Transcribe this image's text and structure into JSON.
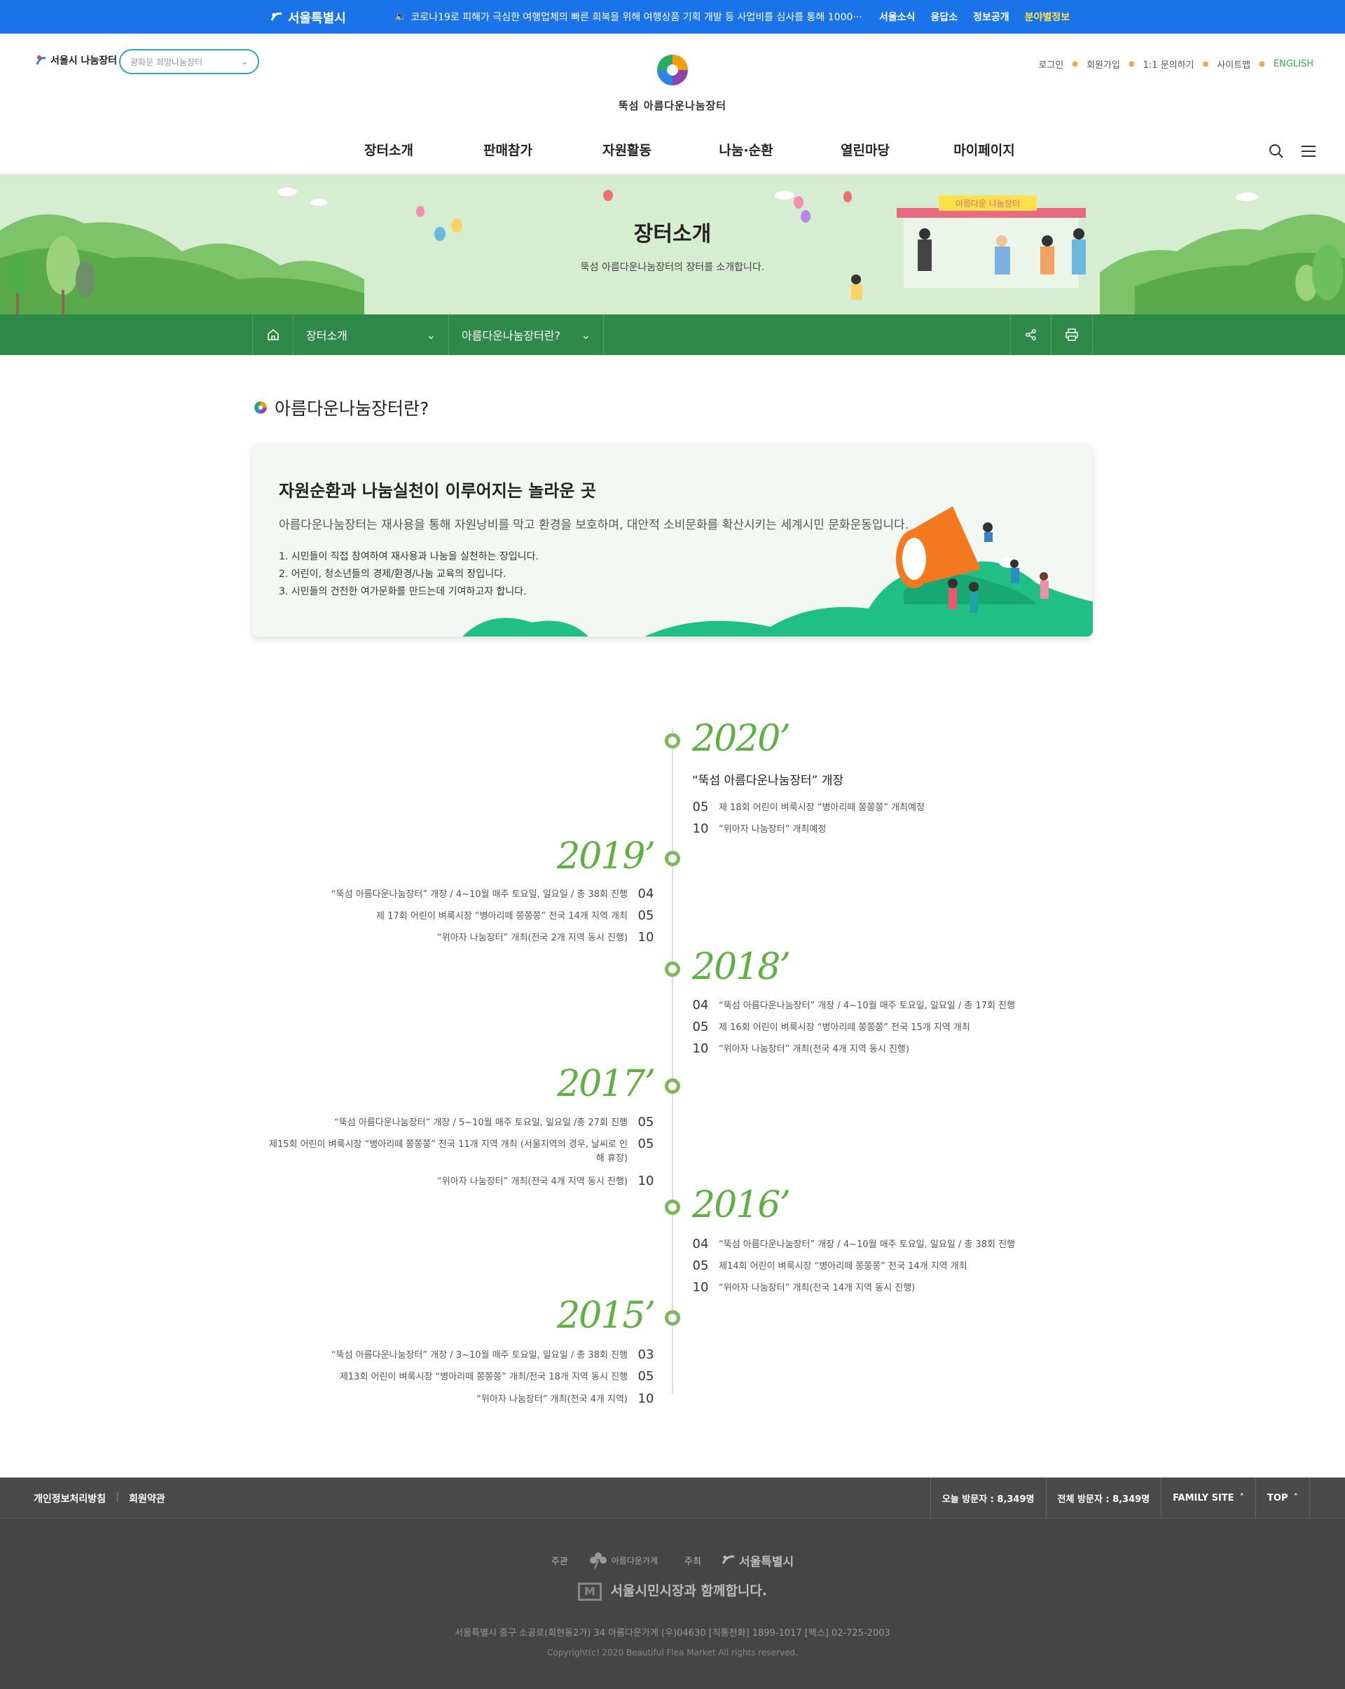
{
  "topbar": {
    "logo": "서울특별시",
    "notice": "코로나19로 피해가 극심한 여행업체의 빠른 회복을 위해 여행상품 기획 개발 등 사업비를 심사를 통해 1000···",
    "links": [
      "서울소식",
      "응답소",
      "정보공개",
      "분야별정보"
    ]
  },
  "header": {
    "site_logo": "서울시 나눔장터",
    "site_select": "광화문 희망나눔장터",
    "center_logo": "뚝섬 아름다운나눔장터",
    "util": [
      "로그인",
      "회원가입",
      "1:1 문의하기",
      "사이트맵",
      "ENGLISH"
    ],
    "gnb": [
      "장터소개",
      "판매참가",
      "자원활동",
      "나눔·순환",
      "열린마당",
      "마이페이지"
    ]
  },
  "banner": {
    "title": "장터소개",
    "subtitle": "뚝섬 아름다운나눔장터의 장터를 소개합니다.",
    "sign": "아름다운 나눔장터"
  },
  "locbar": {
    "depth1": "장터소개",
    "depth2": "아름다운나눔장터란?"
  },
  "section_title": "아름다운나눔장터란?",
  "intro": {
    "heading": "자원순환과 나눔실천이 이루어지는 놀라운 곳",
    "desc": "아름다운나눔장터는 재사용을 통해 자원낭비를 막고 환경을 보호하며, 대안적 소비문화를 확산시키는 세계시민 문화운동입니다.",
    "items": [
      "1. 시민들이 직접 참여하여 재사용과 나눔을 실천하는 장입니다.",
      "2. 어린이, 청소년들의 경제/환경/나눔 교육의 장입니다.",
      "3. 시민들의 건전한 여가문화를 만드는데 기여하고자 합니다."
    ]
  },
  "timeline": [
    {
      "year": "2020’",
      "title": "“뚝섬 아름다운나눔장터” 개장",
      "events": [
        {
          "m": "05",
          "t": "제 18회 어린이 벼룩시장 “병아리떼 쫑쫑쫑” 개최예정"
        },
        {
          "m": "10",
          "t": "“위아자 나눔장터” 개최예정"
        }
      ]
    },
    {
      "year": "2019’",
      "events": [
        {
          "m": "04",
          "t": "“뚝섬 아름다운나눔장터” 개장 / 4~10월 매주 토요일, 일요일 / 총 38회 진행"
        },
        {
          "m": "05",
          "t": "제 17회 어린이 벼룩시장 “병아리떼 쫑쫑쫑” 전국 14개 지역 개최"
        },
        {
          "m": "10",
          "t": "“위아자 나눔장터” 개최(전국 2개 지역 동시 진행)"
        }
      ]
    },
    {
      "year": "2018’",
      "events": [
        {
          "m": "04",
          "t": "“뚝섬 아름다운나눔장터” 개장 / 4~10월 매주 토요일, 일요일 / 총 17회 진행"
        },
        {
          "m": "05",
          "t": "제 16회 어린이 벼룩시장 “병아리떼 쫑쫑쫑” 전국 15개 지역 개최"
        },
        {
          "m": "10",
          "t": "“위아자 나눔장터” 개최(전국 4개 지역 동시 진행)"
        }
      ]
    },
    {
      "year": "2017’",
      "events": [
        {
          "m": "05",
          "t": "“뚝섬 아름다운나눔장터” 개장 / 5~10월 매주 토요일, 일요일 /총 27회 진행"
        },
        {
          "m": "05",
          "t": "제15회 어린이 벼룩시장 “병아리떼 쫑쫑쫑” 전국 11개 지역 개최 (서울지역의 경우, 날씨로 인해 휴장)"
        },
        {
          "m": "10",
          "t": "“위아자 나눔장터” 개최(전국 4개 지역 동시 진행)"
        }
      ]
    },
    {
      "year": "2016’",
      "events": [
        {
          "m": "04",
          "t": "“뚝섬 아름다운나눔장터” 개장 / 4~10월 매주 토요일, 일요일 / 총 38회 진행"
        },
        {
          "m": "05",
          "t": "제14회 어린이 벼룩시장 “병아리떼 쫑쫑쫑” 전국 14개 지역 개최"
        },
        {
          "m": "10",
          "t": "“위아자 나눔장터” 개최(전국 14개 지역 동시 진행)"
        }
      ]
    },
    {
      "year": "2015’",
      "events": [
        {
          "m": "03",
          "t": "“뚝섬 아름다운나눔장터” 개장 / 3~10월 매주 토요일, 일요일 / 총 38회 진행"
        },
        {
          "m": "05",
          "t": "제13회 어린이 벼룩시장 “병아리떼 쫑쫑쫑” 개최/전국 18개 지역 동시 진행"
        },
        {
          "m": "10",
          "t": "“위아자 나눔장터” 개최(전국 4개 지역)"
        }
      ]
    }
  ],
  "footer": {
    "links": [
      "개인정보처리방침",
      "회원약관"
    ],
    "today": "오늘 방문자 : 8,349명",
    "total": "전체 방문자 : 8,349명",
    "family": "FAMILY SITE",
    "top": "TOP",
    "org_label1": "주관",
    "org_name1": "아름다운가게",
    "org_label2": "주최",
    "org_name2": "서울특별시",
    "slogan": "서울시민시장과 함께합니다.",
    "address": "서울특별시 중구 소공로(회현동2가) 34 아름다운가게 (우)04630 [직통전화] 1899-1017 [팩스] 02-725-2003",
    "copyright": "Copyright(c) 2020 Beautiful Flea Market All rights reserved."
  },
  "colors": {
    "topbar": "#1a73e8",
    "locbar": "#2f8a4a",
    "year": "#5eb043",
    "banner": "#d6edd1"
  }
}
